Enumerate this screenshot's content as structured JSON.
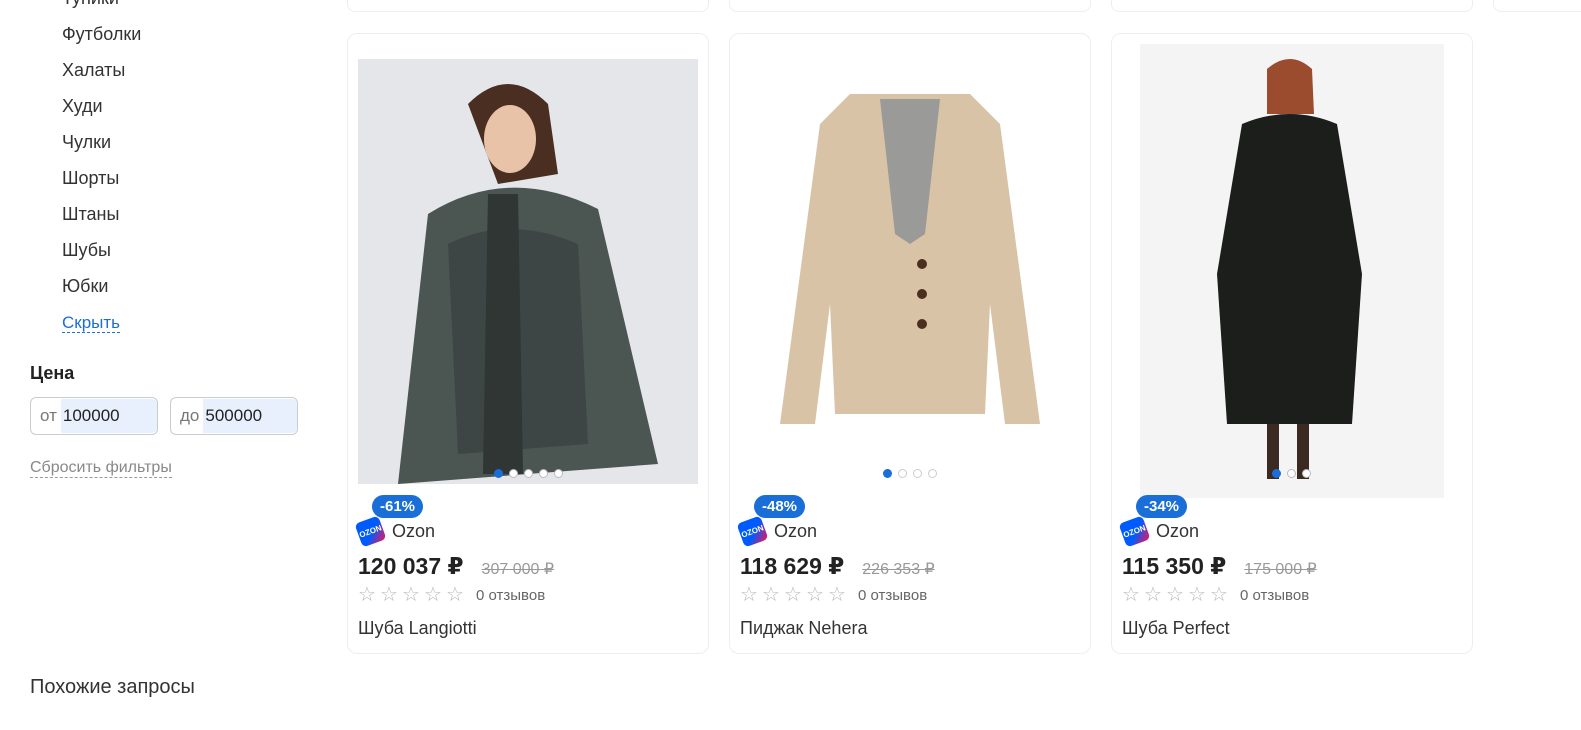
{
  "sidebar": {
    "categories": [
      "Туники",
      "Футболки",
      "Халаты",
      "Худи",
      "Чулки",
      "Шорты",
      "Штаны",
      "Шубы",
      "Юбки"
    ],
    "hide_label": "Скрыть",
    "price": {
      "title": "Цена",
      "from_prefix": "от",
      "from_value": "100000",
      "to_prefix": "до",
      "to_value": "500000"
    },
    "reset_label": "Сбросить фильтры"
  },
  "similar_title": "Похожие запросы",
  "products": [
    {
      "discount": "-61%",
      "seller": "Ozon",
      "price": "120 037 ₽",
      "old_price": "307 000 ₽",
      "reviews": "0 отзывов",
      "title": "Шуба Langiotti",
      "image_dots": 5,
      "active_dot": 0
    },
    {
      "discount": "-48%",
      "seller": "Ozon",
      "price": "118 629 ₽",
      "old_price": "226 353 ₽",
      "reviews": "0 отзывов",
      "title": "Пиджак Nehera",
      "image_dots": 4,
      "active_dot": 0
    },
    {
      "discount": "-34%",
      "seller": "Ozon",
      "price": "115 350 ₽",
      "old_price": "175 000 ₽",
      "reviews": "0 отзывов",
      "title": "Шуба Perfect",
      "image_dots": 3,
      "active_dot": 0
    }
  ],
  "seller_logo_text": "OZON",
  "colors": {
    "accent": "#1a6ed8",
    "dot_active": "#1a6ed8"
  },
  "icons": [
    "star-outline-icon",
    "ozon-logo-icon"
  ]
}
